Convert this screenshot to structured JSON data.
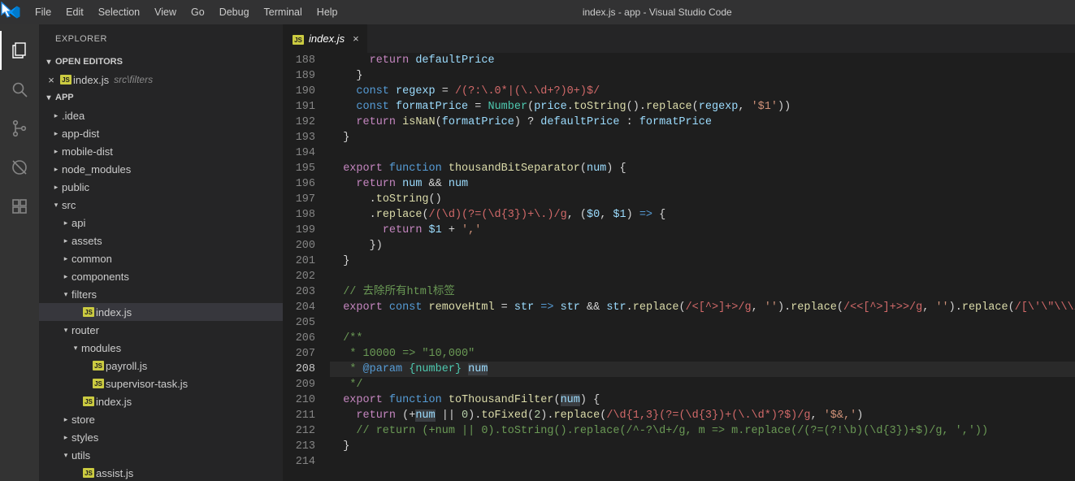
{
  "window": {
    "title": "index.js - app - Visual Studio Code"
  },
  "menu": [
    "File",
    "Edit",
    "Selection",
    "View",
    "Go",
    "Debug",
    "Terminal",
    "Help"
  ],
  "activity": [
    {
      "name": "explorer-icon",
      "active": true
    },
    {
      "name": "search-icon",
      "active": false
    },
    {
      "name": "scm-icon",
      "active": false
    },
    {
      "name": "debug-icon",
      "active": false
    },
    {
      "name": "extensions-icon",
      "active": false
    }
  ],
  "sidebar": {
    "title": "EXPLORER",
    "openEditors": {
      "header": "OPEN EDITORS",
      "items": [
        {
          "icon": "js",
          "label": "index.js",
          "desc": "src\\filters"
        }
      ]
    },
    "workspace": {
      "header": "APP",
      "tree": [
        {
          "depth": 0,
          "kind": "folder",
          "twist": "▸",
          "label": ".idea"
        },
        {
          "depth": 0,
          "kind": "folder",
          "twist": "▸",
          "label": "app-dist"
        },
        {
          "depth": 0,
          "kind": "folder",
          "twist": "▸",
          "label": "mobile-dist"
        },
        {
          "depth": 0,
          "kind": "folder",
          "twist": "▸",
          "label": "node_modules"
        },
        {
          "depth": 0,
          "kind": "folder",
          "twist": "▸",
          "label": "public"
        },
        {
          "depth": 0,
          "kind": "folder",
          "twist": "▾",
          "label": "src"
        },
        {
          "depth": 1,
          "kind": "folder",
          "twist": "▸",
          "label": "api"
        },
        {
          "depth": 1,
          "kind": "folder",
          "twist": "▸",
          "label": "assets"
        },
        {
          "depth": 1,
          "kind": "folder",
          "twist": "▸",
          "label": "common"
        },
        {
          "depth": 1,
          "kind": "folder",
          "twist": "▸",
          "label": "components"
        },
        {
          "depth": 1,
          "kind": "folder",
          "twist": "▾",
          "label": "filters"
        },
        {
          "depth": 2,
          "kind": "js",
          "twist": "",
          "label": "index.js",
          "selected": true
        },
        {
          "depth": 1,
          "kind": "folder",
          "twist": "▾",
          "label": "router"
        },
        {
          "depth": 2,
          "kind": "folder",
          "twist": "▾",
          "label": "modules"
        },
        {
          "depth": 3,
          "kind": "js",
          "twist": "",
          "label": "payroll.js"
        },
        {
          "depth": 3,
          "kind": "js",
          "twist": "",
          "label": "supervisor-task.js"
        },
        {
          "depth": 2,
          "kind": "js",
          "twist": "",
          "label": "index.js"
        },
        {
          "depth": 1,
          "kind": "folder",
          "twist": "▸",
          "label": "store"
        },
        {
          "depth": 1,
          "kind": "folder",
          "twist": "▸",
          "label": "styles"
        },
        {
          "depth": 1,
          "kind": "folder",
          "twist": "▾",
          "label": "utils"
        },
        {
          "depth": 2,
          "kind": "js",
          "twist": "",
          "label": "assist.js"
        }
      ]
    }
  },
  "editor": {
    "tab": {
      "icon": "js",
      "label": "index.js"
    },
    "firstLine": 188,
    "currentLine": 208,
    "lines": [
      [
        [
          "      ",
          ""
        ],
        [
          "return",
          "c-kw2"
        ],
        [
          " ",
          ""
        ],
        [
          "defaultPrice",
          "c-var"
        ]
      ],
      [
        [
          "    }",
          "c-pn"
        ]
      ],
      [
        [
          "    ",
          ""
        ],
        [
          "const",
          "c-kw"
        ],
        [
          " ",
          ""
        ],
        [
          "regexp",
          "c-var"
        ],
        [
          " = ",
          "c-pn"
        ],
        [
          "/(?:\\.0*|(\\.\\d+?)0+)$/",
          "c-re"
        ]
      ],
      [
        [
          "    ",
          ""
        ],
        [
          "const",
          "c-kw"
        ],
        [
          " ",
          ""
        ],
        [
          "formatPrice",
          "c-var"
        ],
        [
          " = ",
          "c-pn"
        ],
        [
          "Number",
          "c-ty"
        ],
        [
          "(",
          "c-pn"
        ],
        [
          "price",
          "c-var"
        ],
        [
          ".",
          "c-pn"
        ],
        [
          "toString",
          "c-fn"
        ],
        [
          "().",
          "c-pn"
        ],
        [
          "replace",
          "c-fn"
        ],
        [
          "(",
          "c-pn"
        ],
        [
          "regexp",
          "c-var"
        ],
        [
          ", ",
          "c-pn"
        ],
        [
          "'$1'",
          "c-str"
        ],
        [
          "))",
          "c-pn"
        ]
      ],
      [
        [
          "    ",
          ""
        ],
        [
          "return",
          "c-kw2"
        ],
        [
          " ",
          ""
        ],
        [
          "isNaN",
          "c-fn"
        ],
        [
          "(",
          "c-pn"
        ],
        [
          "formatPrice",
          "c-var"
        ],
        [
          ") ? ",
          "c-pn"
        ],
        [
          "defaultPrice",
          "c-var"
        ],
        [
          " : ",
          "c-pn"
        ],
        [
          "formatPrice",
          "c-var"
        ]
      ],
      [
        [
          "  }",
          "c-pn"
        ]
      ],
      [
        [
          "",
          ""
        ]
      ],
      [
        [
          "  ",
          ""
        ],
        [
          "export",
          "c-kw2"
        ],
        [
          " ",
          ""
        ],
        [
          "function",
          "c-kw"
        ],
        [
          " ",
          ""
        ],
        [
          "thousandBitSeparator",
          "c-fn"
        ],
        [
          "(",
          "c-pn"
        ],
        [
          "num",
          "c-var"
        ],
        [
          ") {",
          "c-pn"
        ]
      ],
      [
        [
          "    ",
          ""
        ],
        [
          "return",
          "c-kw2"
        ],
        [
          " ",
          ""
        ],
        [
          "num",
          "c-var"
        ],
        [
          " && ",
          "c-pn"
        ],
        [
          "num",
          "c-var"
        ]
      ],
      [
        [
          "      .",
          ""
        ],
        [
          "toString",
          "c-fn"
        ],
        [
          "()",
          "c-pn"
        ]
      ],
      [
        [
          "      .",
          ""
        ],
        [
          "replace",
          "c-fn"
        ],
        [
          "(",
          "c-pn"
        ],
        [
          "/(\\d)(?=(\\d{3})+\\.)/g",
          "c-re"
        ],
        [
          ", (",
          "c-pn"
        ],
        [
          "$0",
          "c-var"
        ],
        [
          ", ",
          "c-pn"
        ],
        [
          "$1",
          "c-var"
        ],
        [
          ") ",
          "c-pn"
        ],
        [
          "=>",
          "c-kw"
        ],
        [
          " {",
          "c-pn"
        ]
      ],
      [
        [
          "        ",
          ""
        ],
        [
          "return",
          "c-kw2"
        ],
        [
          " ",
          ""
        ],
        [
          "$1",
          "c-var"
        ],
        [
          " + ",
          "c-pn"
        ],
        [
          "','",
          "c-str"
        ]
      ],
      [
        [
          "      })",
          "c-pn"
        ]
      ],
      [
        [
          "  }",
          "c-pn"
        ]
      ],
      [
        [
          "",
          ""
        ]
      ],
      [
        [
          "  ",
          ""
        ],
        [
          "// 去除所有html标签",
          "c-cm"
        ]
      ],
      [
        [
          "  ",
          ""
        ],
        [
          "export",
          "c-kw2"
        ],
        [
          " ",
          ""
        ],
        [
          "const",
          "c-kw"
        ],
        [
          " ",
          ""
        ],
        [
          "removeHtml",
          "c-fn"
        ],
        [
          " = ",
          "c-pn"
        ],
        [
          "str",
          "c-var"
        ],
        [
          " ",
          "c-pn"
        ],
        [
          "=>",
          "c-kw"
        ],
        [
          " ",
          "c-pn"
        ],
        [
          "str",
          "c-var"
        ],
        [
          " && ",
          "c-pn"
        ],
        [
          "str",
          "c-var"
        ],
        [
          ".",
          "c-pn"
        ],
        [
          "replace",
          "c-fn"
        ],
        [
          "(",
          "c-pn"
        ],
        [
          "/<[^>]+>/g",
          "c-re"
        ],
        [
          ", ",
          "c-pn"
        ],
        [
          "''",
          "c-str"
        ],
        [
          ").",
          "c-pn"
        ],
        [
          "replace",
          "c-fn"
        ],
        [
          "(",
          "c-pn"
        ],
        [
          "/<<[^>]+>>/g",
          "c-re"
        ],
        [
          ", ",
          "c-pn"
        ],
        [
          "''",
          "c-str"
        ],
        [
          ").",
          "c-pn"
        ],
        [
          "replace",
          "c-fn"
        ],
        [
          "(",
          "c-pn"
        ],
        [
          "/[\\'\\\"\\\\\\/\\b\\f\\n",
          "c-re"
        ]
      ],
      [
        [
          "",
          ""
        ]
      ],
      [
        [
          "  ",
          ""
        ],
        [
          "/**",
          "c-cm"
        ]
      ],
      [
        [
          "   ",
          ""
        ],
        [
          "* 10000 => \"10,000\"",
          "c-cm"
        ]
      ],
      [
        [
          "   ",
          ""
        ],
        [
          "* ",
          "c-cm"
        ],
        [
          "@param",
          "c-kw"
        ],
        [
          " ",
          "c-cm"
        ],
        [
          "{number}",
          "c-ty"
        ],
        [
          " ",
          "c-cm"
        ],
        [
          "num",
          "c-var",
          true
        ]
      ],
      [
        [
          "   ",
          ""
        ],
        [
          "*/",
          "c-cm"
        ]
      ],
      [
        [
          "  ",
          ""
        ],
        [
          "export",
          "c-kw2"
        ],
        [
          " ",
          ""
        ],
        [
          "function",
          "c-kw"
        ],
        [
          " ",
          ""
        ],
        [
          "toThousandFilter",
          "c-fn"
        ],
        [
          "(",
          "c-pn"
        ],
        [
          "num",
          "c-var",
          true
        ],
        [
          ") {",
          "c-pn"
        ]
      ],
      [
        [
          "    ",
          ""
        ],
        [
          "return",
          "c-kw2"
        ],
        [
          " (+",
          "c-pn"
        ],
        [
          "num",
          "c-var",
          true
        ],
        [
          " || ",
          "c-pn"
        ],
        [
          "0",
          "c-num"
        ],
        [
          ").",
          "c-pn"
        ],
        [
          "toFixed",
          "c-fn"
        ],
        [
          "(",
          "c-pn"
        ],
        [
          "2",
          "c-num"
        ],
        [
          ").",
          "c-pn"
        ],
        [
          "replace",
          "c-fn"
        ],
        [
          "(",
          "c-pn"
        ],
        [
          "/\\d{1,3}(?=(\\d{3})+(\\.\\d*)?$)/g",
          "c-re"
        ],
        [
          ", ",
          "c-pn"
        ],
        [
          "'$&,'",
          "c-str"
        ],
        [
          ")",
          "c-pn"
        ]
      ],
      [
        [
          "    ",
          ""
        ],
        [
          "// return (+num || 0).toString().replace(/^-?\\d+/g, m => m.replace(/(?=(?!\\b)(\\d{3})+$)/g, ','))",
          "c-cm"
        ]
      ],
      [
        [
          "  }",
          "c-pn"
        ]
      ],
      [
        [
          "",
          ""
        ]
      ]
    ]
  }
}
